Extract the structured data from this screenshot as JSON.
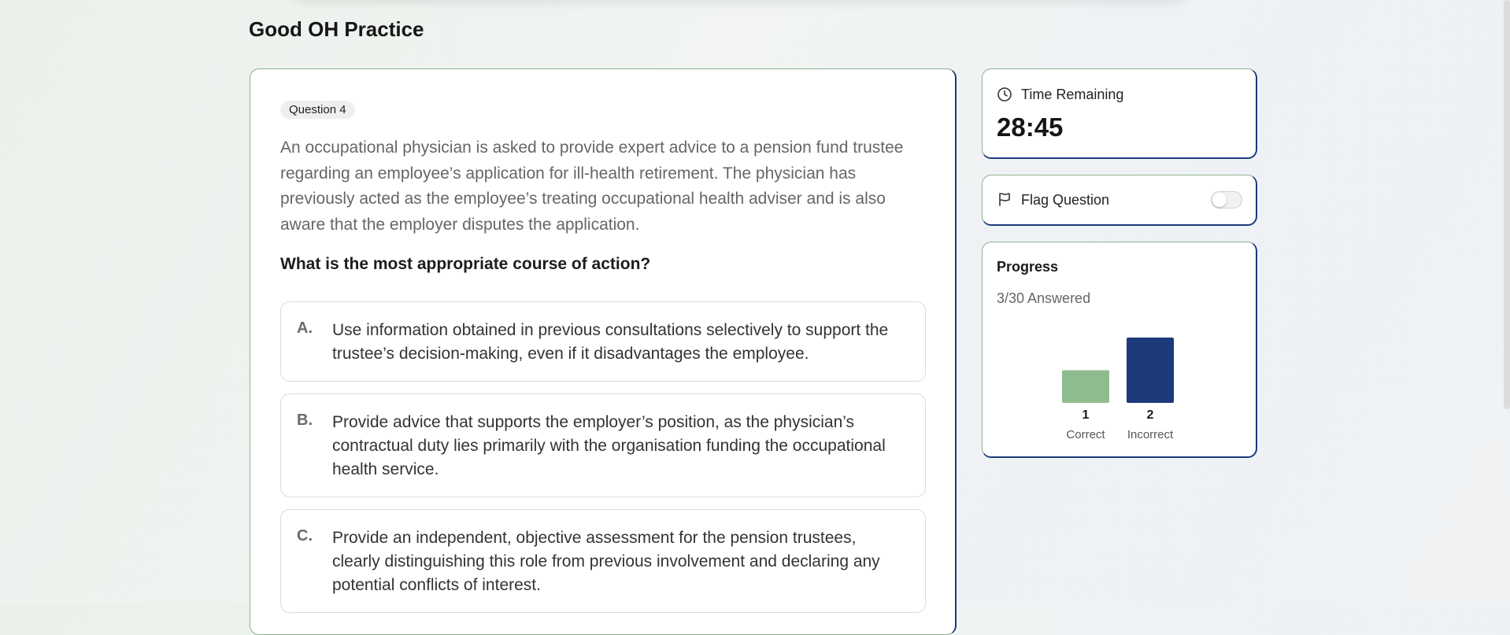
{
  "page": {
    "title": "Good OH Practice"
  },
  "question": {
    "badge": "Question 4",
    "stem": "An occupational physician is asked to provide expert advice to a pension fund trustee regarding an employee’s application for ill-health retirement. The physician has previously acted as the employee’s treating occupational health adviser and is also aware that the employer disputes the application.",
    "prompt": "What is the most appropriate course of action?",
    "options": [
      {
        "letter": "A.",
        "text": "Use information obtained in previous consultations selectively to support the trustee’s decision-making, even if it disadvantages the employee."
      },
      {
        "letter": "B.",
        "text": "Provide advice that supports the employer’s position, as the physician’s contractual duty lies primarily with the organisation funding the occupational health service."
      },
      {
        "letter": "C.",
        "text": "Provide an independent, objective assessment for the pension trustees, clearly distinguishing this role from previous involvement and declaring any potential conflicts of interest."
      }
    ]
  },
  "timer": {
    "label": "Time Remaining",
    "value": "28:45",
    "icon": "clock-icon"
  },
  "flag": {
    "label": "Flag Question",
    "icon": "flag-icon",
    "on": false
  },
  "progress": {
    "title": "Progress",
    "answered": "3/30 Answered",
    "colors": {
      "correct": "#8fbc8f",
      "incorrect": "#1c3a7a"
    }
  },
  "chart_data": {
    "type": "bar",
    "categories": [
      "Correct",
      "Incorrect"
    ],
    "values": [
      1,
      2
    ],
    "colors": [
      "#8fbc8f",
      "#1c3a7a"
    ]
  }
}
